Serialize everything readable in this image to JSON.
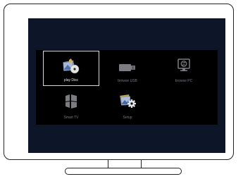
{
  "menu": {
    "items": [
      {
        "label": "play Disc",
        "icon": "play-disc-icon",
        "selected": true
      },
      {
        "label": "browse USB",
        "icon": "usb-drive-icon",
        "selected": false
      },
      {
        "label": "browse PC",
        "icon": "network-pc-icon",
        "selected": false
      },
      {
        "label": "Smart TV",
        "icon": "smart-tv-icon",
        "selected": false
      },
      {
        "label": "Setup",
        "icon": "setup-icon",
        "selected": false
      }
    ]
  },
  "colors": {
    "screen_background": "#0d1529",
    "panel_background": "#000000",
    "selection_border": "#d8d8d8",
    "label_text": "#777a82",
    "selected_label_text": "#e6e6e6",
    "inactive_icon": "#7b7d82"
  }
}
